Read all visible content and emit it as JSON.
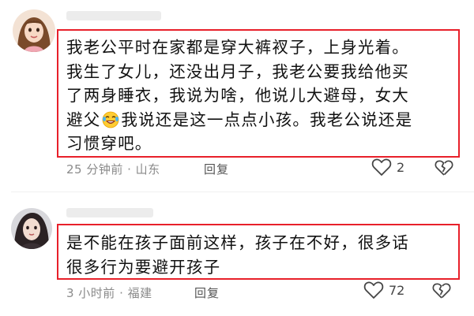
{
  "comments": [
    {
      "lines": [
        "我老公平时在家都是穿大裤衩子，上身光着。",
        "我生了女儿，还没出月子，我老公要我给他买",
        "了两身睡衣，我说为啥，他说儿大避母，女大"
      ],
      "line4_before_emoji": "避父",
      "line4_after_emoji": "我说还是这一点点小孩。我老公说还是",
      "line5": "习惯穿吧。",
      "emoji_icon": "laughing-crying-emoji-icon",
      "time_location": "25 分钟前 · 山东",
      "reply_label": "回复",
      "like_count": "2"
    },
    {
      "lines": [
        "是不能在孩子面前这样，孩子在不好，很多话",
        "很多行为要避开孩子"
      ],
      "time_location": "3 小时前 · 福建",
      "reply_label": "回复",
      "like_count": "72"
    }
  ],
  "colors": {
    "highlight_border": "#e8202a",
    "meta_text": "#8a8a8a"
  }
}
